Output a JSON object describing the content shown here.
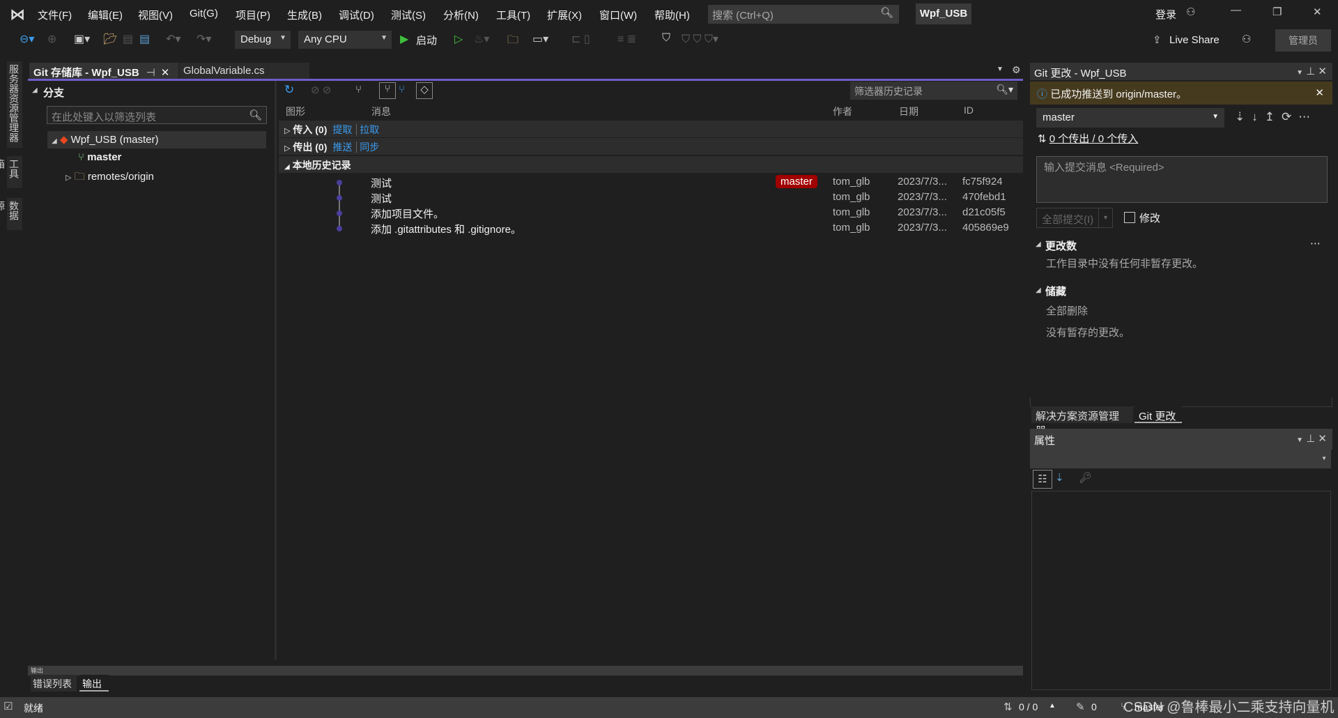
{
  "menubar": {
    "items": [
      "文件(F)",
      "编辑(E)",
      "视图(V)",
      "Git(G)",
      "项目(P)",
      "生成(B)",
      "调试(D)",
      "测试(S)",
      "分析(N)",
      "工具(T)",
      "扩展(X)",
      "窗口(W)",
      "帮助(H)"
    ],
    "search_placeholder": "搜索 (Ctrl+Q)",
    "solution_name": "Wpf_USB",
    "sign_in": "登录"
  },
  "toolbar": {
    "configuration": "Debug",
    "platform": "Any CPU",
    "start": "启动",
    "live_share": "Live Share",
    "admin": "管理员"
  },
  "side_tabs": [
    "服务器资源管理器",
    "工具箱",
    "数据源"
  ],
  "doc_tabs": [
    {
      "label": "Git 存储库 - Wpf_USB",
      "active": true
    },
    {
      "label": "GlobalVariable.cs",
      "active": false
    }
  ],
  "branches": {
    "header": "分支",
    "filter_placeholder": "在此处键入以筛选列表",
    "repo": "Wpf_USB (master)",
    "branch": "master",
    "remote": "remotes/origin"
  },
  "history": {
    "filter_placeholder": "筛选器历史记录",
    "columns": [
      "图形",
      "消息",
      "作者",
      "日期",
      "ID"
    ],
    "incoming": {
      "label": "传入 (0)",
      "links": [
        "提取",
        "拉取"
      ]
    },
    "outgoing": {
      "label": "传出 (0)",
      "links": [
        "推送",
        "同步"
      ]
    },
    "local": "本地历史记录",
    "commits": [
      {
        "message": "测试",
        "tag": "master",
        "author": "tom_glb",
        "date": "2023/7/3...",
        "id": "fc75f924"
      },
      {
        "message": "测试",
        "tag": "",
        "author": "tom_glb",
        "date": "2023/7/3...",
        "id": "470febd1"
      },
      {
        "message": "添加项目文件。",
        "tag": "",
        "author": "tom_glb",
        "date": "2023/7/3...",
        "id": "d21c05f5"
      },
      {
        "message": "添加 .gitattributes 和 .gitignore。",
        "tag": "",
        "author": "tom_glb",
        "date": "2023/7/3...",
        "id": "405869e9"
      }
    ]
  },
  "git_changes": {
    "title": "Git 更改 - Wpf_USB",
    "info": "已成功推送到 origin/master。",
    "branch": "master",
    "sync_text": "0 个传出 / 0 个传入",
    "commit_placeholder": "输入提交消息 <Required>",
    "commit_all": "全部提交(I)",
    "amend": "修改",
    "changes_header": "更改数",
    "changes_text": "工作目录中没有任何非暂存更改。",
    "stash_header": "储藏",
    "stash_delete": "全部删除",
    "stash_text": "没有暂存的更改。"
  },
  "right_tabs": [
    "解决方案资源管理器",
    "Git 更改"
  ],
  "properties": {
    "title": "属性"
  },
  "bottom": {
    "panel_title": "输出",
    "tabs": [
      "错误列表",
      "输出"
    ]
  },
  "status": {
    "ready": "就绪",
    "sync": "0 / 0",
    "edits": "0",
    "branch": "master",
    "watermark": "CSDN @鲁棒最小二乘支持向量机"
  }
}
